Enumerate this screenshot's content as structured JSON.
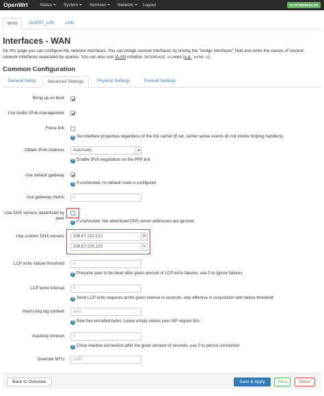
{
  "navbar": {
    "brand": "OpenWrt",
    "items": [
      {
        "label": "Status",
        "caret": true
      },
      {
        "label": "System",
        "caret": true
      },
      {
        "label": "Services",
        "caret": true
      },
      {
        "label": "Network",
        "caret": true
      },
      {
        "label": "Logout",
        "caret": false
      }
    ],
    "auto_refresh": "AUTO REFRESH ON",
    "auto_refresh_color": "#5cb85c"
  },
  "interface_tabs": [
    "WAN",
    "GUEST_LAN",
    "LAN"
  ],
  "page": {
    "title": "Interfaces - WAN",
    "desc_line1": "On this page you can configure the network interfaces. You can bridge several interfaces by ticking the \"bridge interfaces\" field and enter the names of several",
    "desc_line2_pre": "network interfaces separated by spaces. You can also use ",
    "desc_vlan": "VLAN",
    "desc_notation": " notation ",
    "desc_code1": "INTERFACE.VLANNR",
    "desc_eg_open": " (",
    "desc_eg": "e.g.",
    "desc_eg_colon": ": ",
    "desc_code2": "eth0.1",
    "desc_close": ")."
  },
  "section": {
    "title": "Common Configuration",
    "tabs": [
      "General Setup",
      "Advanced Settings",
      "Physical Settings",
      "Firewall Settings"
    ]
  },
  "fields": {
    "bring_up": {
      "label": "Bring up on boot",
      "checked": true
    },
    "ipv6_mgmt": {
      "label": "Use builtin IPv6-management",
      "checked": true
    },
    "force_link": {
      "label": "Force link",
      "checked": false,
      "help": "Set interface properties regardless of the link carrier (If set, carrier sense events do not invoke hotplug handlers)."
    },
    "obtain_ipv6": {
      "label": "Obtain IPv6-Address",
      "value": "Automatic",
      "help": "Enable IPv6 negotiation on the PPP link"
    },
    "default_gw": {
      "label": "Use default gateway",
      "checked": true,
      "help": "If unchecked, no default route is configured"
    },
    "gw_metric": {
      "label": "Use gateway metric",
      "value": "0"
    },
    "peer_dns": {
      "label_line1": "Use DNS servers advertised by",
      "label_line2": "peer",
      "checked": false,
      "help": "If unchecked, the advertised DNS server addresses are ignored"
    },
    "custom_dns": {
      "label": "Use custom DNS servers",
      "values": [
        "208.67.222.222",
        "208.67.220.220"
      ],
      "remove": "×",
      "add": "+"
    },
    "lcp_failure": {
      "label": "LCP echo failure threshold",
      "value": "0",
      "help": "Presume peer to be dead after given amount of LCP echo failures, use 0 to ignore failures"
    },
    "lcp_interval": {
      "label": "LCP echo interval",
      "value": "5",
      "help": "Send LCP echo requests at the given interval in seconds, only effective in conjunction with failure threshold"
    },
    "host_uniq": {
      "label": "Host-Uniq tag content",
      "placeholder": "auto",
      "help": "Raw hex-encoded bytes. Leave empty unless your ISP require this"
    },
    "inactivity": {
      "label": "Inactivity timeout",
      "value": "0",
      "help": "Close inactive connection after the given amount of seconds, use 0 to persist connection"
    },
    "mtu": {
      "label": "Override MTU",
      "value": "1492"
    }
  },
  "footer": {
    "back": "Back to Overview",
    "save_apply": "Save & Apply",
    "save": "Save",
    "reset": "Reset"
  },
  "help_icon": "?",
  "icons": {
    "help": "question-circle-icon",
    "remove": "close-icon",
    "add": "plus-icon",
    "caret": "caret-down-icon"
  },
  "colors": {
    "highlight_box": "#e03b3b",
    "primary": "#337ab7",
    "success": "#5cb85c",
    "danger": "#d9534f",
    "navbar": "#2b2b2b"
  }
}
